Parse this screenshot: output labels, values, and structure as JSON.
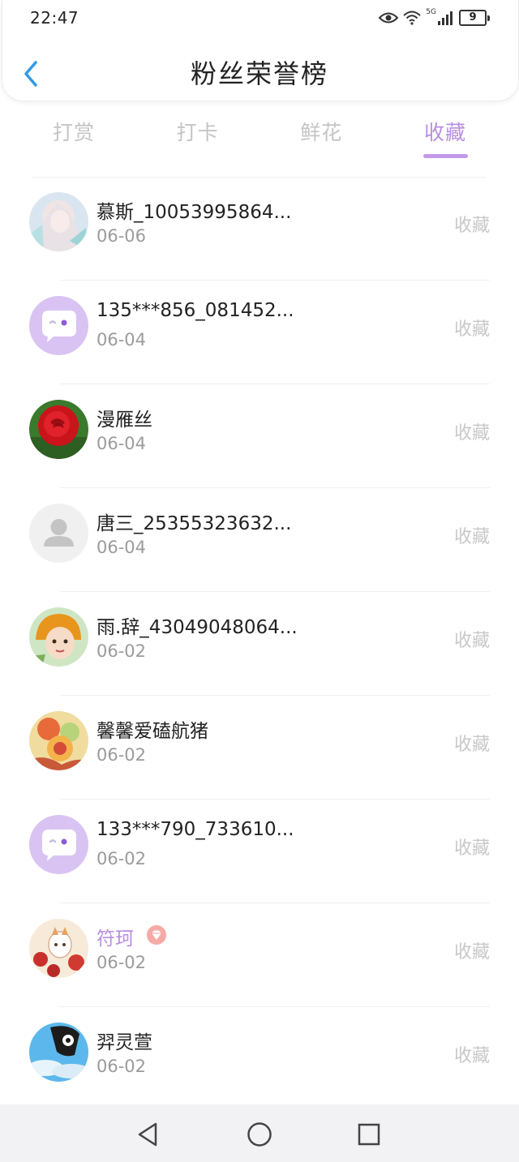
{
  "status_bar": {
    "time": "22:47",
    "network": "5G",
    "battery": "9",
    "icons": [
      "eye-icon",
      "wifi-icon",
      "signal-icon",
      "battery-icon"
    ]
  },
  "header": {
    "title": "粉丝荣誉榜",
    "back_icon": "chevron-left-icon"
  },
  "tabs": [
    {
      "label": "打赏",
      "active": false
    },
    {
      "label": "打卡",
      "active": false
    },
    {
      "label": "鲜花",
      "active": false
    },
    {
      "label": "收藏",
      "active": true
    }
  ],
  "colors": {
    "accent": "#b88fe0",
    "back_arrow": "#2f9ae8",
    "inactive_tab": "#c4c4c4",
    "action_text": "#c8c8c8"
  },
  "list": [
    {
      "name": "慕斯_10053995864...",
      "date": "06-06",
      "action": "收藏",
      "avatar": "anime-girl-avatar"
    },
    {
      "name": "135***856_081452...",
      "date": "06-04",
      "action": "收藏",
      "avatar": "default-chat-avatar"
    },
    {
      "name": "漫雁丝",
      "date": "06-04",
      "action": "收藏",
      "avatar": "rose-avatar"
    },
    {
      "name": "唐三_25355323632...",
      "date": "06-04",
      "action": "收藏",
      "avatar": "person-placeholder-avatar"
    },
    {
      "name": "雨.辞_43049048064...",
      "date": "06-02",
      "action": "收藏",
      "avatar": "cartoon-girl-avatar"
    },
    {
      "name": "馨馨爱磕航猪",
      "date": "06-02",
      "action": "收藏",
      "avatar": "colorful-art-avatar"
    },
    {
      "name": "133***790_733610...",
      "date": "06-02",
      "action": "收藏",
      "avatar": "default-chat-avatar"
    },
    {
      "name": "符珂",
      "date": "06-02",
      "action": "收藏",
      "avatar": "red-flower-illustration-avatar",
      "vip": true
    },
    {
      "name": "羿灵萱",
      "date": "06-02",
      "action": "收藏",
      "avatar": "sky-panda-avatar"
    }
  ],
  "nav_bar": {
    "buttons": [
      "back-triangle-icon",
      "home-circle-icon",
      "recents-square-icon"
    ]
  }
}
